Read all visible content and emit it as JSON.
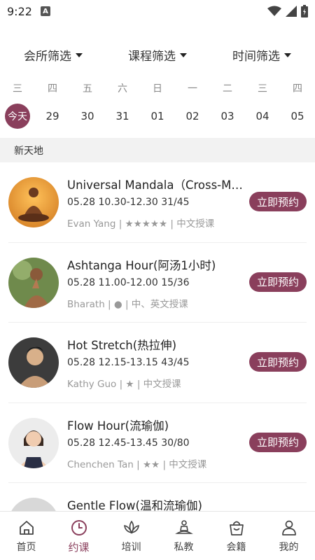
{
  "status": {
    "time": "9:22",
    "app_icon": "A"
  },
  "filters": [
    {
      "label": "会所筛选"
    },
    {
      "label": "课程筛选"
    },
    {
      "label": "时间筛选"
    }
  ],
  "weekdays": [
    "三",
    "四",
    "五",
    "六",
    "日",
    "一",
    "二",
    "三",
    "四"
  ],
  "dates": [
    "今天",
    "29",
    "30",
    "31",
    "01",
    "02",
    "03",
    "04",
    "05"
  ],
  "section": {
    "title": "新天地"
  },
  "classes": [
    {
      "title": "Universal Mandala（Cross-Mat ...",
      "meta": "05.28 10.30-12.30   31/45",
      "teacher": "Evan Yang | ★★★★★ | 中文授课",
      "button": "立即预约"
    },
    {
      "title": "Ashtanga Hour(阿汤1小时)",
      "meta": "05.28 11.00-12.00   15/36",
      "teacher": "Bharath | ● | 中、英文授课",
      "button": "立即预约"
    },
    {
      "title": "Hot Stretch(热拉伸)",
      "meta": "05.28 12.15-13.15   43/45",
      "teacher": "Kathy Guo | ★ | 中文授课",
      "button": "立即预约"
    },
    {
      "title": "Flow Hour(流瑜伽)",
      "meta": "05.28 12.45-13.45   30/80",
      "teacher": "Chenchen Tan | ★★ | 中文授课",
      "button": "立即预约"
    },
    {
      "title": "Gentle Flow(温和流瑜伽)",
      "meta": "",
      "teacher": "",
      "button": ""
    }
  ],
  "nav": [
    {
      "label": "首页",
      "icon": "home-icon"
    },
    {
      "label": "约课",
      "icon": "clock-icon"
    },
    {
      "label": "培训",
      "icon": "lotus-icon"
    },
    {
      "label": "私教",
      "icon": "meditation-icon"
    },
    {
      "label": "会籍",
      "icon": "bag-icon"
    },
    {
      "label": "我的",
      "icon": "user-icon"
    }
  ],
  "colors": {
    "accent": "#8a3f5c",
    "section_bg": "#f2f2f2"
  }
}
